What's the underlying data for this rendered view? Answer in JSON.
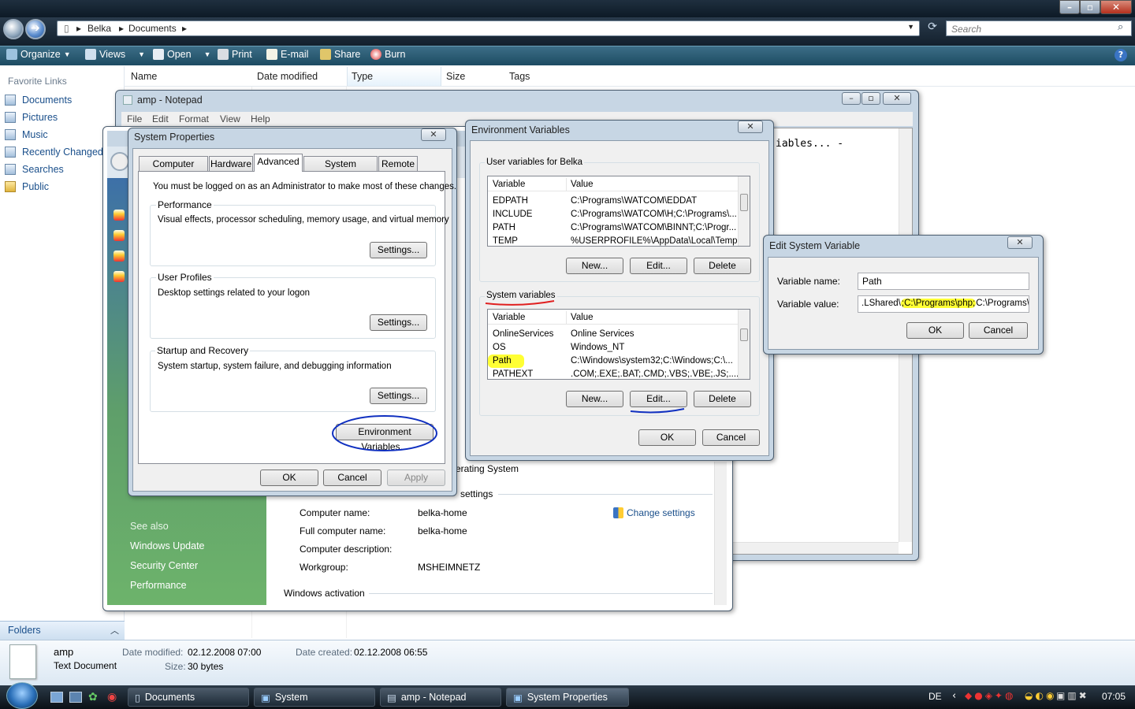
{
  "explorer": {
    "breadcrumb": [
      "Belka",
      "Documents"
    ],
    "search_placeholder": "Search",
    "toolbar": [
      "Organize",
      "Views",
      "Open",
      "Print",
      "E-mail",
      "Share",
      "Burn"
    ],
    "favorite_links_title": "Favorite Links",
    "favorites": [
      "Documents",
      "Pictures",
      "Music",
      "Recently Changed",
      "Searches",
      "Public"
    ],
    "columns": [
      "Name",
      "Date modified",
      "Type",
      "Size",
      "Tags"
    ],
    "folders_label": "Folders",
    "details": {
      "name": "amp",
      "type": "Text Document",
      "date_modified_label": "Date modified:",
      "date_modified": "02.12.2008 07:00",
      "size_label": "Size:",
      "size": "30 bytes",
      "date_created_label": "Date created:",
      "date_created": "02.12.2008 06:55"
    }
  },
  "taskbar": {
    "tasks": [
      "Documents",
      "System",
      "amp - Notepad",
      "System Properties"
    ],
    "lang": "DE",
    "clock": "07:05"
  },
  "notepad": {
    "title": "amp - Notepad",
    "menu": [
      "File",
      "Edit",
      "Format",
      "View",
      "Help"
    ],
    "visible_text": "iables... -"
  },
  "system_window": {
    "see_also_title": "See also",
    "see_also": [
      "Windows Update",
      "Security Center",
      "Performance"
    ],
    "operating_system_fragment": "erating System",
    "settings_fragment": "settings",
    "rows": [
      {
        "label": "Computer name:",
        "value": "belka-home"
      },
      {
        "label": "Full computer name:",
        "value": "belka-home"
      },
      {
        "label": "Computer description:",
        "value": ""
      },
      {
        "label": "Workgroup:",
        "value": "MSHEIMNETZ"
      }
    ],
    "change_settings": "Change settings",
    "activation": "Windows activation"
  },
  "system_properties": {
    "title": "System Properties",
    "tabs": [
      "Computer Name",
      "Hardware",
      "Advanced",
      "System Protection",
      "Remote"
    ],
    "active_tab": "Advanced",
    "admin_note": "You must be logged on as an Administrator to make most of these changes.",
    "performance": {
      "title": "Performance",
      "desc": "Visual effects, processor scheduling, memory usage, and virtual memory",
      "button": "Settings..."
    },
    "profiles": {
      "title": "User Profiles",
      "desc": "Desktop settings related to your logon",
      "button": "Settings..."
    },
    "startup": {
      "title": "Startup and Recovery",
      "desc": "System startup, system failure, and debugging information",
      "button": "Settings..."
    },
    "env_button": "Environment Variables...",
    "ok": "OK",
    "cancel": "Cancel",
    "apply": "Apply"
  },
  "env_vars": {
    "title": "Environment Variables",
    "user_title": "User variables for Belka",
    "col_variable": "Variable",
    "col_value": "Value",
    "user_vars": [
      {
        "name": "EDPATH",
        "value": "C:\\Programs\\WATCOM\\EDDAT"
      },
      {
        "name": "INCLUDE",
        "value": "C:\\Programs\\WATCOM\\H;C:\\Programs\\..."
      },
      {
        "name": "PATH",
        "value": "C:\\Programs\\WATCOM\\BINNT;C:\\Progr..."
      },
      {
        "name": "TEMP",
        "value": "%USERPROFILE%\\AppData\\Local\\Temp"
      }
    ],
    "system_title": "System variables",
    "system_vars": [
      {
        "name": "OnlineServices",
        "value": "Online Services"
      },
      {
        "name": "OS",
        "value": "Windows_NT"
      },
      {
        "name": "Path",
        "value": "C:\\Windows\\system32;C:\\Windows;C:\\..."
      },
      {
        "name": "PATHEXT",
        "value": ".COM;.EXE;.BAT;.CMD;.VBS;.VBE;.JS;...."
      }
    ],
    "new": "New...",
    "edit": "Edit...",
    "delete": "Delete",
    "ok": "OK",
    "cancel": "Cancel"
  },
  "edit_var": {
    "title": "Edit System Variable",
    "name_label": "Variable name:",
    "name_value": "Path",
    "value_label": "Variable value:",
    "value_pre": ".LShared\\",
    "value_hl1": ";C:\\Programs\\php;",
    "value_post": "C:\\Programs\\M",
    "ok": "OK",
    "cancel": "Cancel"
  },
  "colors": {
    "highlight": "#ffff33",
    "annotation_red": "#e02020",
    "annotation_blue": "#1030c0",
    "link": "#1a4f8b"
  }
}
